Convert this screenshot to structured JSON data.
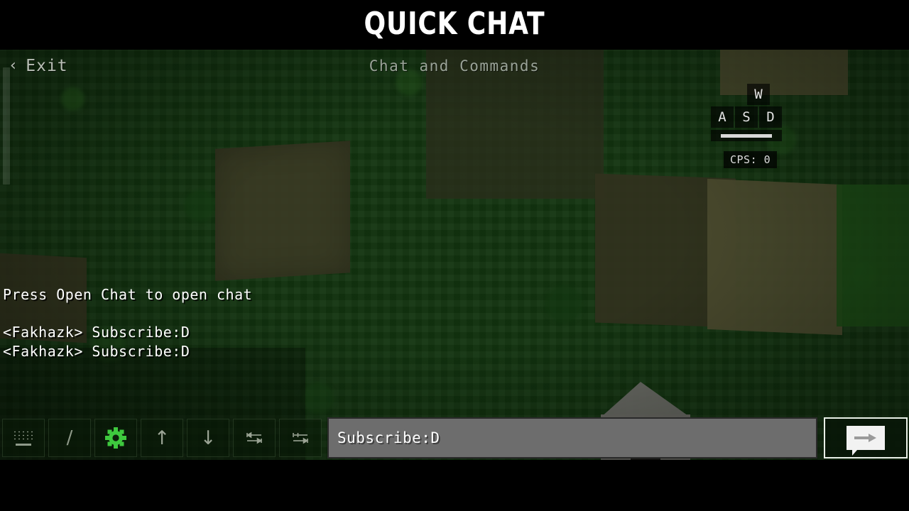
{
  "titlebar": {
    "title": "QUICK CHAT"
  },
  "header": {
    "exit_chevron": "‹",
    "exit_label": "Exit",
    "subtitle": "Chat and Commands"
  },
  "hud": {
    "keys": {
      "w": "W",
      "a": "A",
      "s": "S",
      "d": "D"
    },
    "cps_label": "CPS: 0"
  },
  "chat": {
    "hint": "Press Open Chat to open chat",
    "messages": [
      "<Fakhazk> Subscribe:D",
      "<Fakhazk> Subscribe:D"
    ]
  },
  "toolbar": {
    "buttons": [
      {
        "name": "keyboard-button",
        "icon": "keyboard-icon",
        "label": ""
      },
      {
        "name": "slash-command-button",
        "icon": "slash-icon",
        "label": "/"
      },
      {
        "name": "settings-button",
        "icon": "gear-icon",
        "label": ""
      },
      {
        "name": "scroll-up-button",
        "icon": "arrow-up-icon",
        "label": "↑"
      },
      {
        "name": "scroll-down-button",
        "icon": "arrow-down-icon",
        "label": "↓"
      },
      {
        "name": "prev-word-button",
        "icon": "skip-previous-icon",
        "label": ""
      },
      {
        "name": "next-word-button",
        "icon": "skip-next-icon",
        "label": ""
      }
    ]
  },
  "input": {
    "value": "Subscribe:D",
    "placeholder": "Subscribe:D"
  },
  "send": {
    "icon": "send-message-icon"
  },
  "colors": {
    "accent_gear_green": "#3ec93e",
    "input_background": "#6d6d6d",
    "title_text": "#ffffff",
    "subtitle_text": "#9aa398",
    "world_green": "#12330f"
  }
}
